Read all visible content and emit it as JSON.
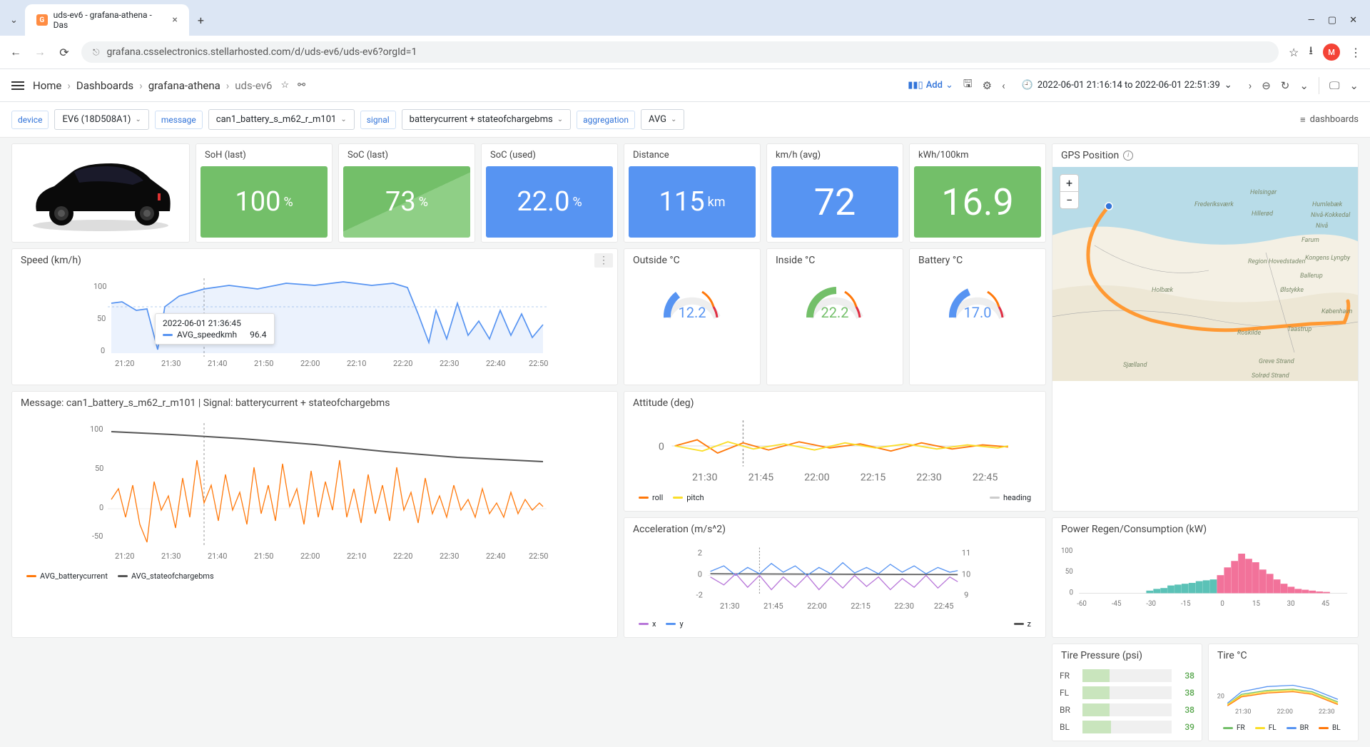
{
  "browser": {
    "tab_title": "uds-ev6 - grafana-athena - Das",
    "url": "grafana.csselectronics.stellarhosted.com/d/uds-ev6/uds-ev6?orgId=1",
    "avatar_initial": "M"
  },
  "breadcrumb": {
    "home": "Home",
    "dashboards": "Dashboards",
    "folder": "grafana-athena",
    "current": "uds-ev6"
  },
  "header": {
    "add": "Add",
    "time_range": "2022-06-01 21:16:14 to 2022-06-01 22:51:39"
  },
  "vars": {
    "device_label": "device",
    "device_value": "EV6 (18D508A1)",
    "message_label": "message",
    "message_value": "can1_battery_s_m62_r_m101",
    "signal_label": "signal",
    "signal_value": "batterycurrent + stateofchargebms",
    "aggregation_label": "aggregation",
    "aggregation_value": "AVG",
    "dashboards_link": "dashboards"
  },
  "stats": {
    "soh": {
      "label": "SoH (last)",
      "value": "100",
      "unit": "%"
    },
    "soc": {
      "label": "SoC (last)",
      "value": "73",
      "unit": "%"
    },
    "soc_used": {
      "label": "SoC (used)",
      "value": "22.0",
      "unit": "%"
    },
    "distance": {
      "label": "Distance",
      "value": "115",
      "unit": "km"
    },
    "kmh": {
      "label": "km/h (avg)",
      "value": "72",
      "unit": ""
    },
    "kwh": {
      "label": "kWh/100km",
      "value": "16.9",
      "unit": ""
    }
  },
  "speed_panel": {
    "title": "Speed (km/h)",
    "tooltip_time": "2022-06-01 21:36:45",
    "tooltip_series": "AVG_speedkmh",
    "tooltip_value": "96.4"
  },
  "temps": {
    "outside": {
      "label": "Outside °C",
      "value": "12.2",
      "color": "#5794f2"
    },
    "inside": {
      "label": "Inside °C",
      "value": "22.2",
      "color": "#73bf69"
    },
    "battery": {
      "label": "Battery °C",
      "value": "17.0",
      "color": "#5794f2"
    }
  },
  "map_panel": {
    "title": "GPS Position"
  },
  "attitude_panel": {
    "title": "Attitude (deg)",
    "legend": {
      "roll": "roll",
      "pitch": "pitch",
      "heading": "heading"
    }
  },
  "msg_panel": {
    "title": "Message: can1_battery_s_m62_r_m101 | Signal: batterycurrent + stateofchargebms",
    "legend": {
      "a": "AVG_batterycurrent",
      "b": "AVG_stateofchargebms"
    }
  },
  "accel_panel": {
    "title": "Acceleration (m/s^2)",
    "legend": {
      "x": "x",
      "y": "y",
      "z": "z"
    }
  },
  "power_panel": {
    "title": "Power Regen/Consumption (kW)"
  },
  "tire_p": {
    "title": "Tire Pressure (psi)",
    "rows": [
      {
        "lbl": "FR",
        "val": "38",
        "pct": 30
      },
      {
        "lbl": "FL",
        "val": "38",
        "pct": 30
      },
      {
        "lbl": "BR",
        "val": "38",
        "pct": 30
      },
      {
        "lbl": "BL",
        "val": "39",
        "pct": 32
      }
    ]
  },
  "tire_t": {
    "title": "Tire °C",
    "legend": {
      "fr": "FR",
      "fl": "FL",
      "br": "BR",
      "bl": "BL"
    }
  },
  "chart_data": [
    {
      "name": "speed",
      "type": "line",
      "title": "Speed (km/h)",
      "ylabel": "",
      "ylim": [
        0,
        120
      ],
      "x_ticks": [
        "21:20",
        "21:30",
        "21:40",
        "21:50",
        "22:00",
        "22:10",
        "22:20",
        "22:30",
        "22:40",
        "22:50"
      ],
      "y_ticks": [
        0,
        50,
        100
      ],
      "series": [
        {
          "name": "AVG_speedkmh",
          "color": "#5794f2",
          "x": [
            "21:16",
            "21:20",
            "21:25",
            "21:28",
            "21:30",
            "21:32",
            "21:36",
            "21:40",
            "21:45",
            "21:50",
            "21:55",
            "22:00",
            "22:05",
            "22:10",
            "22:15",
            "22:18",
            "22:20",
            "22:22",
            "22:25",
            "22:30",
            "22:35",
            "22:40",
            "22:45",
            "22:50"
          ],
          "y": [
            70,
            72,
            60,
            5,
            68,
            80,
            96.4,
            105,
            100,
            108,
            110,
            105,
            112,
            108,
            110,
            105,
            60,
            20,
            55,
            30,
            65,
            25,
            60,
            25
          ]
        }
      ],
      "hline": 63
    },
    {
      "name": "message_signal",
      "type": "line",
      "title": "batterycurrent + stateofchargebms",
      "ylim": [
        -60,
        110
      ],
      "x_ticks": [
        "21:20",
        "21:30",
        "21:40",
        "21:50",
        "22:00",
        "22:10",
        "22:20",
        "22:30",
        "22:40",
        "22:50"
      ],
      "y_ticks": [
        -50,
        0,
        50,
        100
      ],
      "series": [
        {
          "name": "AVG_batterycurrent",
          "color": "#ff780a",
          "x": [
            "21:16",
            "21:20",
            "21:25",
            "21:30",
            "21:35",
            "21:40",
            "21:45",
            "21:50",
            "21:55",
            "22:00",
            "22:05",
            "22:10",
            "22:15",
            "22:20",
            "22:25",
            "22:30",
            "22:35",
            "22:40",
            "22:45",
            "22:50"
          ],
          "y": [
            15,
            10,
            -60,
            30,
            -20,
            45,
            20,
            55,
            10,
            50,
            -10,
            60,
            15,
            40,
            -15,
            20,
            5,
            30,
            -5,
            15
          ]
        },
        {
          "name": "AVG_stateofchargebms",
          "color": "#555",
          "x": [
            "21:16",
            "21:30",
            "21:45",
            "22:00",
            "22:15",
            "22:30",
            "22:45",
            "22:51"
          ],
          "y": [
            96,
            94,
            91,
            88,
            84,
            80,
            76,
            73
          ]
        }
      ]
    },
    {
      "name": "attitude",
      "type": "line",
      "title": "Attitude (deg)",
      "ylim": [
        -5,
        5
      ],
      "x_ticks": [
        "21:30",
        "21:45",
        "22:00",
        "22:15",
        "22:30",
        "22:45"
      ],
      "y_ticks": [
        0
      ],
      "series": [
        {
          "name": "roll",
          "color": "#ff780a",
          "x": [
            "21:16",
            "22:51"
          ],
          "y": [
            0.2,
            -0.1
          ]
        },
        {
          "name": "pitch",
          "color": "#fade2a",
          "x": [
            "21:16",
            "22:51"
          ],
          "y": [
            -0.3,
            0.4
          ]
        },
        {
          "name": "heading",
          "color": "#ccc",
          "x": [
            "21:16",
            "22:51"
          ],
          "y": [
            0,
            0
          ]
        }
      ]
    },
    {
      "name": "acceleration",
      "type": "line",
      "title": "Acceleration (m/s^2)",
      "x_ticks": [
        "21:30",
        "21:45",
        "22:00",
        "22:15",
        "22:30",
        "22:45"
      ],
      "y_left": {
        "lim": [
          -2,
          2
        ],
        "ticks": [
          -2,
          0,
          2
        ]
      },
      "y_right": {
        "lim": [
          9,
          11
        ],
        "ticks": [
          9,
          10,
          11
        ]
      },
      "series": [
        {
          "name": "x",
          "color": "#b877d9",
          "axis": "left",
          "x": [
            "21:16",
            "22:51"
          ],
          "y": [
            -0.2,
            0.1
          ]
        },
        {
          "name": "y",
          "color": "#5794f2",
          "axis": "left",
          "x": [
            "21:16",
            "22:51"
          ],
          "y": [
            0.4,
            0.3
          ]
        },
        {
          "name": "z",
          "color": "#555",
          "axis": "right",
          "x": [
            "21:16",
            "22:51"
          ],
          "y": [
            9.9,
            10.0
          ]
        }
      ]
    },
    {
      "name": "power_histogram",
      "type": "bar",
      "title": "Power Regen/Consumption (kW)",
      "xlabel": "",
      "ylim": [
        0,
        100
      ],
      "x_ticks": [
        -60,
        -45,
        -30,
        -15,
        0,
        15,
        30,
        45
      ],
      "y_ticks": [
        0,
        50,
        100
      ],
      "bars": [
        {
          "x": -30,
          "y": 6,
          "color": "#5bc2b7"
        },
        {
          "x": -27,
          "y": 10,
          "color": "#5bc2b7"
        },
        {
          "x": -24,
          "y": 12,
          "color": "#5bc2b7"
        },
        {
          "x": -21,
          "y": 18,
          "color": "#5bc2b7"
        },
        {
          "x": -18,
          "y": 20,
          "color": "#5bc2b7"
        },
        {
          "x": -15,
          "y": 22,
          "color": "#5bc2b7"
        },
        {
          "x": -12,
          "y": 24,
          "color": "#5bc2b7"
        },
        {
          "x": -9,
          "y": 28,
          "color": "#5bc2b7"
        },
        {
          "x": -6,
          "y": 30,
          "color": "#5bc2b7"
        },
        {
          "x": -3,
          "y": 32,
          "color": "#5bc2b7"
        },
        {
          "x": 0,
          "y": 42,
          "color": "#f2729a"
        },
        {
          "x": 3,
          "y": 60,
          "color": "#f2729a"
        },
        {
          "x": 6,
          "y": 75,
          "color": "#f2729a"
        },
        {
          "x": 9,
          "y": 92,
          "color": "#f2729a"
        },
        {
          "x": 12,
          "y": 80,
          "color": "#f2729a"
        },
        {
          "x": 15,
          "y": 72,
          "color": "#f2729a"
        },
        {
          "x": 18,
          "y": 55,
          "color": "#f2729a"
        },
        {
          "x": 21,
          "y": 45,
          "color": "#f2729a"
        },
        {
          "x": 24,
          "y": 32,
          "color": "#f2729a"
        },
        {
          "x": 27,
          "y": 22,
          "color": "#f2729a"
        },
        {
          "x": 30,
          "y": 15,
          "color": "#f2729a"
        },
        {
          "x": 33,
          "y": 10,
          "color": "#f2729a"
        },
        {
          "x": 36,
          "y": 8,
          "color": "#f2729a"
        },
        {
          "x": 39,
          "y": 6,
          "color": "#f2729a"
        },
        {
          "x": 42,
          "y": 4,
          "color": "#f2729a"
        },
        {
          "x": 45,
          "y": 3,
          "color": "#f2729a"
        }
      ]
    },
    {
      "name": "tire_pressure",
      "type": "bar",
      "title": "Tire Pressure (psi)",
      "categories": [
        "FR",
        "FL",
        "BR",
        "BL"
      ],
      "values": [
        38,
        38,
        38,
        39
      ]
    },
    {
      "name": "tire_temp",
      "type": "line",
      "title": "Tire °C",
      "ylim": [
        15,
        30
      ],
      "x_ticks": [
        "21:30",
        "22:00",
        "22:30"
      ],
      "y_ticks": [
        20
      ],
      "series": [
        {
          "name": "FR",
          "color": "#73bf69",
          "x": [
            "21:16",
            "21:30",
            "22:00",
            "22:30",
            "22:51"
          ],
          "y": [
            18,
            22,
            24,
            23,
            20
          ]
        },
        {
          "name": "FL",
          "color": "#fade2a",
          "x": [
            "21:16",
            "21:30",
            "22:00",
            "22:30",
            "22:51"
          ],
          "y": [
            18,
            21,
            23,
            22,
            19
          ]
        },
        {
          "name": "BR",
          "color": "#5794f2",
          "x": [
            "21:16",
            "21:30",
            "22:00",
            "22:30",
            "22:51"
          ],
          "y": [
            18,
            23,
            25,
            24,
            20
          ]
        },
        {
          "name": "BL",
          "color": "#ff780a",
          "x": [
            "21:16",
            "21:30",
            "22:00",
            "22:30",
            "22:51"
          ],
          "y": [
            18,
            21,
            22,
            21,
            19
          ]
        }
      ]
    }
  ]
}
